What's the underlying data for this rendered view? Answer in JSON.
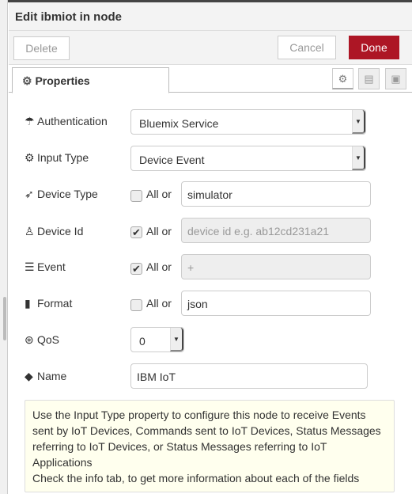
{
  "header": {
    "title": "Edit ibmiot in node"
  },
  "toolbar": {
    "delete": "Delete",
    "cancel": "Cancel",
    "done": "Done"
  },
  "tabs": {
    "properties": "Properties"
  },
  "form": {
    "authentication": {
      "label": "Authentication",
      "value": "Bluemix Service"
    },
    "input_type": {
      "label": "Input Type",
      "value": "Device Event"
    },
    "device_type": {
      "label": "Device Type",
      "all_checked": false,
      "all_label": "All or",
      "value": "simulator"
    },
    "device_id": {
      "label": "Device Id",
      "all_checked": true,
      "all_label": "All or",
      "placeholder": "device id e.g. ab12cd231a21"
    },
    "event": {
      "label": "Event",
      "all_checked": true,
      "all_label": "All or",
      "value": "+"
    },
    "format": {
      "label": "Format",
      "all_checked": false,
      "all_label": "All or",
      "value": "json"
    },
    "qos": {
      "label": "QoS",
      "value": "0"
    },
    "name": {
      "label": "Name",
      "value": "IBM IoT"
    }
  },
  "tip": {
    "lines": [
      "Use the Input Type property to configure this node to receive Events sent by IoT Devices, Commands sent to IoT Devices, Status Messages referring to IoT Devices, or Status Messages referring to IoT Applications",
      "Check the info tab, to get more information about each of the fields"
    ]
  },
  "colors": {
    "done": "#ad1625",
    "tip_bg": "#ffffee"
  }
}
